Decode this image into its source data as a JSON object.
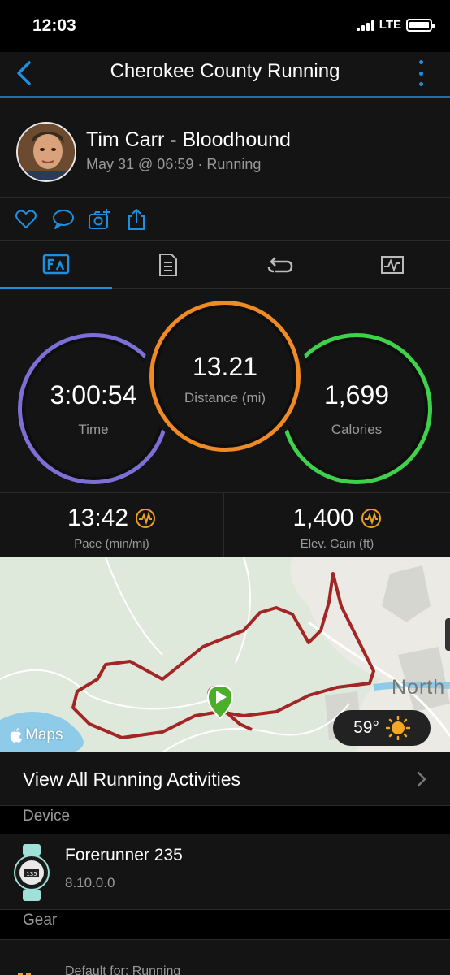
{
  "status_bar": {
    "time": "12:03",
    "network": "LTE"
  },
  "navbar": {
    "title": "Cherokee County Running"
  },
  "profile": {
    "name": "Tim Carr - Bloodhound",
    "meta": "May 31 @ 06:59 · Running"
  },
  "stats": {
    "time": {
      "value": "3:00:54",
      "label": "Time",
      "color": "#7d6fd6"
    },
    "distance": {
      "value": "13.21",
      "label": "Distance (mi)",
      "color": "#f08a24"
    },
    "calories": {
      "value": "1,699",
      "label": "Calories",
      "color": "#3fd14a"
    }
  },
  "metrics": {
    "pace": {
      "value": "13:42",
      "label": "Pace (min/mi)"
    },
    "elevation": {
      "value": "1,400",
      "label": "Elev. Gain (ft)"
    }
  },
  "map": {
    "provider_label": "Maps",
    "town_label": "North",
    "temperature": "59°",
    "route_color": "#a32525",
    "start_marker_color": "#4caf2a"
  },
  "view_all": {
    "label": "View All Running Activities"
  },
  "device_section": {
    "header": "Device",
    "name": "Forerunner 235",
    "version": "8.10.0.0"
  },
  "gear_section": {
    "header": "Gear",
    "default_text": "Default for: Running"
  },
  "colors": {
    "accent": "#1f8fe0",
    "background": "#141414"
  }
}
